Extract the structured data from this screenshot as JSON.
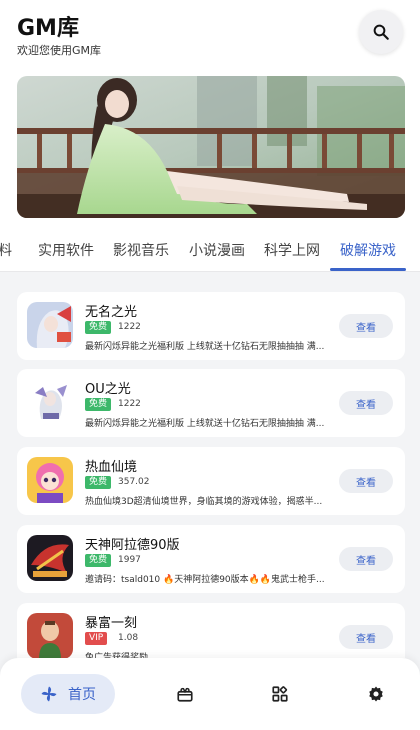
{
  "header": {
    "title": "GM库",
    "subtitle": "欢迎您使用GM库",
    "search_icon": "search-icon"
  },
  "tabs": [
    {
      "label": "料",
      "active": false
    },
    {
      "label": "实用软件",
      "active": false
    },
    {
      "label": "影视音乐",
      "active": false
    },
    {
      "label": "小说漫画",
      "active": false
    },
    {
      "label": "科学上网",
      "active": false
    },
    {
      "label": "破解游戏",
      "active": true
    }
  ],
  "apps": [
    {
      "name": "无名之光",
      "badge": "免费",
      "badge_type": "free",
      "count": "1222",
      "desc": "最新闪烁异能之光福利版 上线就送十亿钻石无限抽抽抽 满...",
      "button": "查看"
    },
    {
      "name": "OU之光",
      "badge": "免费",
      "badge_type": "free",
      "count": "1222",
      "desc": "最新闪烁异能之光福利版 上线就送十亿钻石无限抽抽抽 满...",
      "button": "查看"
    },
    {
      "name": "热血仙境",
      "badge": "免费",
      "badge_type": "free",
      "count": "357.02",
      "desc": "热血仙境3D超清仙境世界，身临其境的游戏体验，揭惑半...",
      "button": "查看"
    },
    {
      "name": "天神阿拉德90版",
      "badge": "免费",
      "badge_type": "free",
      "count": "1997",
      "desc": "邀请码：tsald010 🔥天神阿拉德90版本🔥🔥鬼武士枪手...",
      "button": "查看"
    },
    {
      "name": "暴富一刻",
      "badge": "VIP",
      "badge_type": "vip",
      "count": "1.08",
      "desc": "免广告获得奖励",
      "button": "查看"
    }
  ],
  "nav": {
    "home_label": "首页",
    "items": [
      "home-icon",
      "gift-icon",
      "apps-icon",
      "settings-icon"
    ]
  },
  "colors": {
    "accent": "#3a63c9",
    "free_badge": "#3db86a",
    "vip_badge": "#e24d4d"
  }
}
